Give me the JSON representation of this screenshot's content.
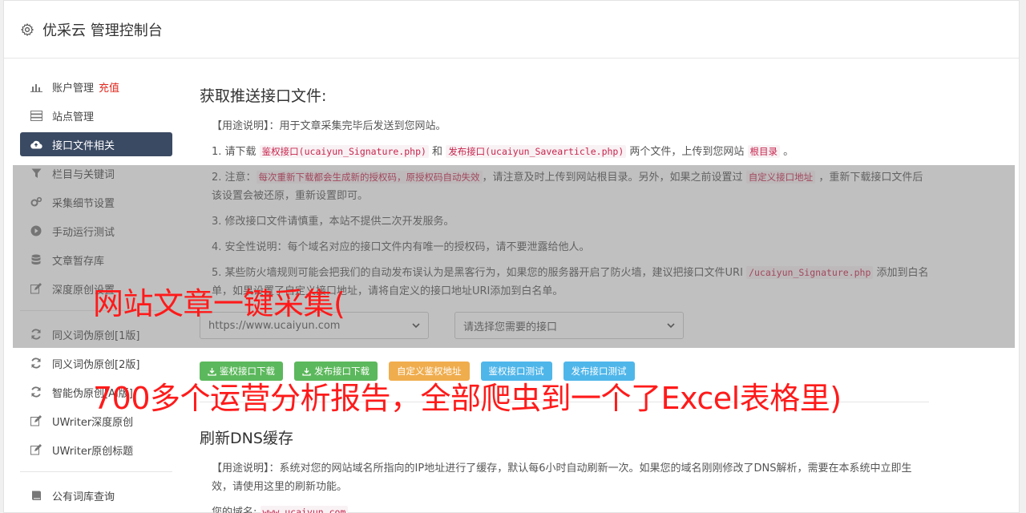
{
  "header": {
    "title": "优采云 管理控制台",
    "icon": "gear-icon"
  },
  "sidebar": {
    "items": [
      {
        "label": "账户管理",
        "extra": "充值",
        "icon": "bar-chart-icon"
      },
      {
        "label": "站点管理",
        "icon": "server-icon"
      },
      {
        "label": "接口文件相关",
        "icon": "cloud-upload-icon",
        "active": true
      },
      {
        "label": "栏目与关键词",
        "icon": "filter-icon"
      },
      {
        "label": "采集细节设置",
        "icon": "cogs-icon"
      },
      {
        "label": "手动运行测试",
        "icon": "play-circle-icon"
      },
      {
        "label": "文章暂存库",
        "icon": "database-icon"
      },
      {
        "label": "深度原创设置",
        "icon": "edit-icon"
      },
      {
        "label": "同义词伪原创[1版]",
        "icon": "refresh-icon"
      },
      {
        "label": "同义词伪原创[2版]",
        "icon": "refresh-icon"
      },
      {
        "label": "智能伪原创[AI版]",
        "icon": "refresh-icon"
      },
      {
        "label": "UWriter深度原创",
        "icon": "edit-icon"
      },
      {
        "label": "UWriter原创标题",
        "icon": "edit-icon"
      },
      {
        "label": "公有词库查询",
        "icon": "book-icon"
      }
    ]
  },
  "main": {
    "section1_title": "获取推送接口文件:",
    "usage": {
      "tag": "【用途说明】",
      "text": "：用于文章采集完毕后发送到您网站。"
    },
    "step1": {
      "prefix": "1. 请下载 ",
      "code1": "鉴权接口(ucaiyun_Signature.php)",
      "mid": " 和 ",
      "code2": "发布接口(ucaiyun_Savearticle.php)",
      "mid2": " 两个文件，上传到您网站 ",
      "code3": "根目录",
      "suffix": " 。"
    },
    "step2": {
      "prefix": "2. 注意：",
      "code1": "每次重新下载都会生成新的授权码，原授权码自动失效",
      "mid": "，请注意及时上传到网站根目录。另外，如果之前设置过 ",
      "code2": "自定义接口地址",
      "suffix": " ，重新下载接口文件后该设置会被还原，重新设置即可。"
    },
    "step3": "3. 修改接口文件请慎重，本站不提供二次开发服务。",
    "step4": "4. 安全性说明：每个域名对应的接口文件内有唯一的授权码，请不要泄露给他人。",
    "step5": {
      "prefix": "5. 某些防火墙规则可能会把我们的自动发布误认为是黑客行为，如果您的服务器开启了防火墙，建议把接口文件URI ",
      "code1": "/ucaiyun_Signature.php",
      "suffix": " 添加到白名单，如果设置了自定义接口地址，请将自定义的接口地址URI添加到白名单。"
    },
    "site_select": "https://www.ucaiyun.com",
    "api_select": "请选择您需要的接口",
    "buttons": {
      "download_sig": "鉴权接口下载",
      "download_pub": "发布接口下载",
      "custom_sig": "自定义鉴权地址",
      "test_sig": "鉴权接口测试",
      "test_pub": "发布接口测试"
    },
    "section2_title": "刷新DNS缓存",
    "dns_usage": {
      "tag": "【用途说明】",
      "text": "：系统对您的网站域名所指向的IP地址进行了缓存，默认每6小时自动刷新一次。如果您的域名刚刚修改了DNS解析，需要在本系统中立即生效，请使用这里的刷新功能。"
    },
    "domain": {
      "label": "您的域名:",
      "value": "www.ucaiyun.com"
    }
  },
  "captions": {
    "line1": "网站文章一键采集(",
    "line2": "700多个运营分析报告，全部爬虫到一个了Excel表格里)"
  },
  "colors": {
    "active_nav": "#3b4a63",
    "code_red": "#c7254e",
    "caption_red": "#ff1a1a",
    "recharge_red": "#e0281e"
  }
}
